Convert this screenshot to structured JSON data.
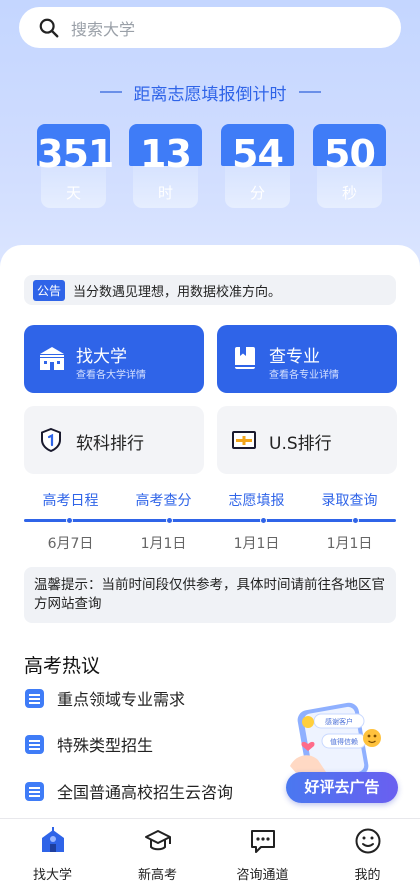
{
  "search": {
    "placeholder": "搜索大学"
  },
  "countdown": {
    "title": "距离志愿填报倒计时",
    "items": [
      {
        "value": "351",
        "unit": "天"
      },
      {
        "value": "13",
        "unit": "时"
      },
      {
        "value": "54",
        "unit": "分"
      },
      {
        "value": "50",
        "unit": "秒"
      }
    ]
  },
  "notice": {
    "tag": "公告",
    "text": "当分数遇见理想，用数据校准方向。"
  },
  "actions": [
    {
      "title": "找大学",
      "subtitle": "查看各大学详情",
      "icon": "university-icon"
    },
    {
      "title": "查专业",
      "subtitle": "查看各专业详情",
      "icon": "book-icon"
    }
  ],
  "rankings": [
    {
      "title": "软科排行",
      "icon": "shield-icon"
    },
    {
      "title": "U.S排行",
      "icon": "us-rank-icon"
    }
  ],
  "timeline": [
    {
      "label": "高考日程",
      "date": "6月7日"
    },
    {
      "label": "高考查分",
      "date": "1月1日"
    },
    {
      "label": "志愿填报",
      "date": "1月1日"
    },
    {
      "label": "录取查询",
      "date": "1月1日"
    }
  ],
  "tip": {
    "text": "温馨提示：当前时间段仅供参考，具体时间请前往各地区官方网站查询"
  },
  "hot": {
    "title": "高考热议",
    "items": [
      "重点领域专业需求",
      "特殊类型招生",
      "全国普通高校招生云咨询"
    ]
  },
  "ad": {
    "button": "好评去广告",
    "bubble1": "感谢客户",
    "bubble2": "值得信赖"
  },
  "tabs": [
    {
      "label": "找大学",
      "icon": "university-icon",
      "active": true
    },
    {
      "label": "新高考",
      "icon": "graduation-cap-icon"
    },
    {
      "label": "咨询通道",
      "icon": "chat-icon"
    },
    {
      "label": "我的",
      "icon": "smile-icon"
    }
  ],
  "colors": {
    "primary": "#2f64e8",
    "hero": "#c4d6ff"
  }
}
